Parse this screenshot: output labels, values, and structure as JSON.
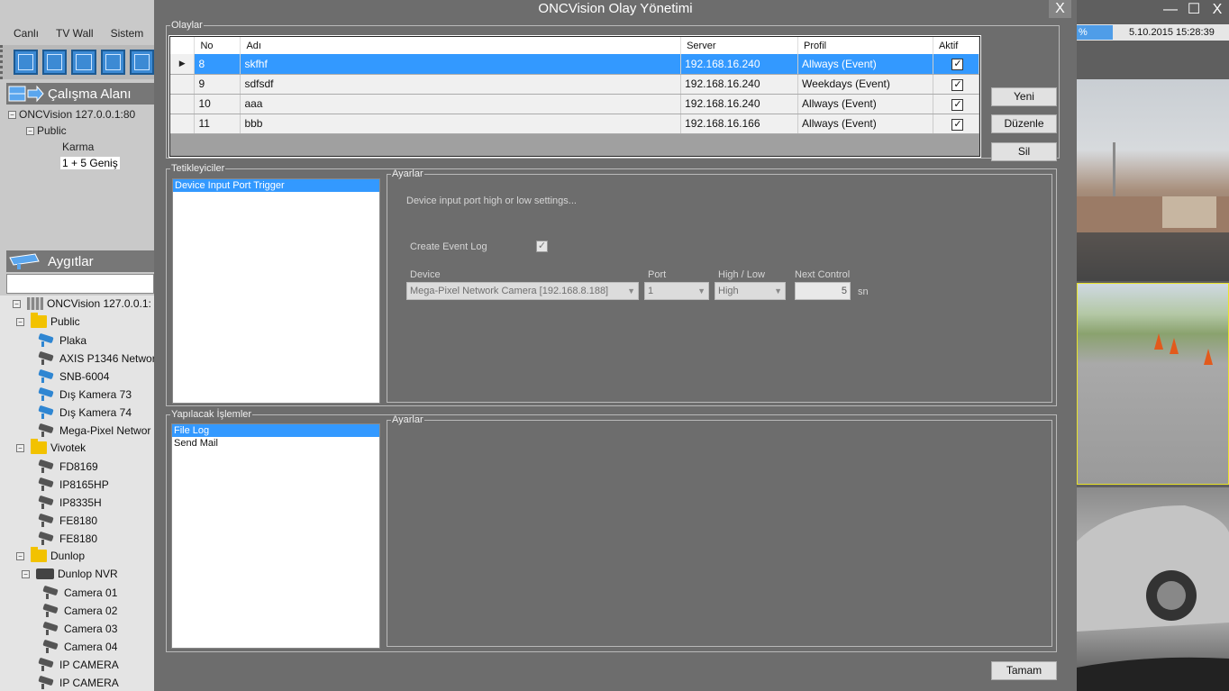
{
  "dialog": {
    "title": "ONCVision Olay Yönetimi",
    "close_label": "X"
  },
  "events": {
    "legend": "Olaylar",
    "columns": {
      "no": "No",
      "name": "Adı",
      "server": "Server",
      "profile": "Profil",
      "active": "Aktif"
    },
    "rows": [
      {
        "no": "8",
        "name": "skfhf",
        "server": "192.168.16.240",
        "profile": "Allways (Event)",
        "active": true
      },
      {
        "no": "9",
        "name": "sdfsdf",
        "server": "192.168.16.240",
        "profile": "Weekdays (Event)",
        "active": true
      },
      {
        "no": "10",
        "name": "aaa",
        "server": "192.168.16.240",
        "profile": "Allways (Event)",
        "active": true
      },
      {
        "no": "11",
        "name": "bbb",
        "server": "192.168.16.166",
        "profile": "Allways (Event)",
        "active": true
      }
    ],
    "selected_row_marker": "▶",
    "checkmark": "✓"
  },
  "buttons": {
    "new": "Yeni",
    "edit": "Düzenle",
    "delete": "Sil",
    "ok": "Tamam"
  },
  "triggers": {
    "legend": "Tetikleyiciler",
    "items": [
      "Device Input Port Trigger"
    ],
    "settings": {
      "legend": "Ayarlar",
      "description": "Device input port high or low settings...",
      "create_event_log_label": "Create Event Log",
      "create_event_log_checked": true,
      "device_label": "Device",
      "device_value": "Mega-Pixel Network Camera [192.168.8.188]",
      "port_label": "Port",
      "port_value": "1",
      "highlow_label": "High / Low",
      "highlow_value": "High",
      "next_control_label": "Next Control",
      "next_control_value": "5",
      "unit": "sn"
    }
  },
  "actions": {
    "legend": "Yapılacak İşlemler",
    "items": [
      "File Log",
      "Send Mail"
    ],
    "settings_legend": "Ayarlar"
  },
  "bg_app": {
    "menu": [
      "Canlı",
      "TV Wall",
      "Sistem"
    ],
    "workspace_title": "Çalışma Alanı",
    "workspace_tree": {
      "root": "ONCVision 127.0.0.1:80",
      "public": "Public",
      "karma": "Karma",
      "genis": "1 + 5  Geniş"
    },
    "devices_title": "Aygıtlar",
    "devices": {
      "root": "ONCVision 127.0.0.1:",
      "public": "Public",
      "public_items": [
        "Plaka",
        "AXIS P1346 Networ",
        "SNB-6004",
        "Dış Kamera 73",
        "Dış Kamera 74",
        "Mega-Pixel Networ"
      ],
      "vivotek": "Vivotek",
      "vivotek_items": [
        "FD8169",
        "IP8165HP",
        "IP8335H",
        "FE8180",
        "FE8180"
      ],
      "dunlop": "Dunlop",
      "dunlop_nvr": "Dunlop NVR",
      "dunlop_items": [
        "Camera 01",
        "Camera 02",
        "Camera 03",
        "Camera 04"
      ],
      "ip_items": [
        "IP CAMERA",
        "IP CAMERA"
      ]
    },
    "status_progress": "%",
    "status_time": "5.10.2015 15:28:39",
    "window_controls": {
      "minimize": "—",
      "maximize": "☐",
      "close": "X"
    }
  }
}
